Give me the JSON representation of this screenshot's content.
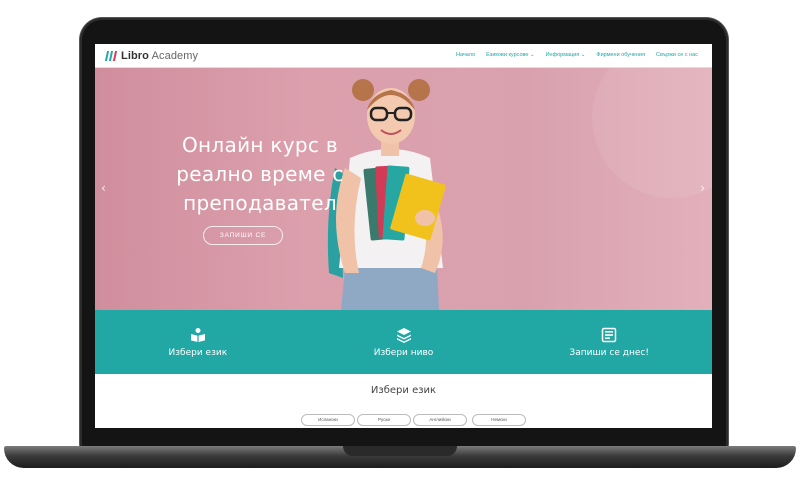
{
  "brand": {
    "name_bold": "Libro",
    "name_light": "Academy"
  },
  "nav": {
    "items": [
      "Начало",
      "Езикови курсове ⌄",
      "Информация ⌄",
      "Фирмени обучения",
      "Свържи се с нас"
    ]
  },
  "hero": {
    "title": "Онлайн курс в\nреално време с\nпреподавател",
    "cta_label": "ЗАПИШИ СЕ",
    "prev_arrow": "‹",
    "next_arrow": "›"
  },
  "features": [
    {
      "label": "Избери език",
      "icon": "open-book-icon"
    },
    {
      "label": "Избери ниво",
      "icon": "layers-icon"
    },
    {
      "label": "Запиши се днес!",
      "icon": "form-icon"
    }
  ],
  "choose_language": {
    "title": "Избери език",
    "options": [
      "Испански",
      "Руски",
      "Английски",
      "Немски"
    ]
  },
  "colors": {
    "accent": "#21a7a4",
    "hero_bg": "#d9a1ae",
    "logo_red": "#d23b55",
    "frame": "#141414"
  }
}
